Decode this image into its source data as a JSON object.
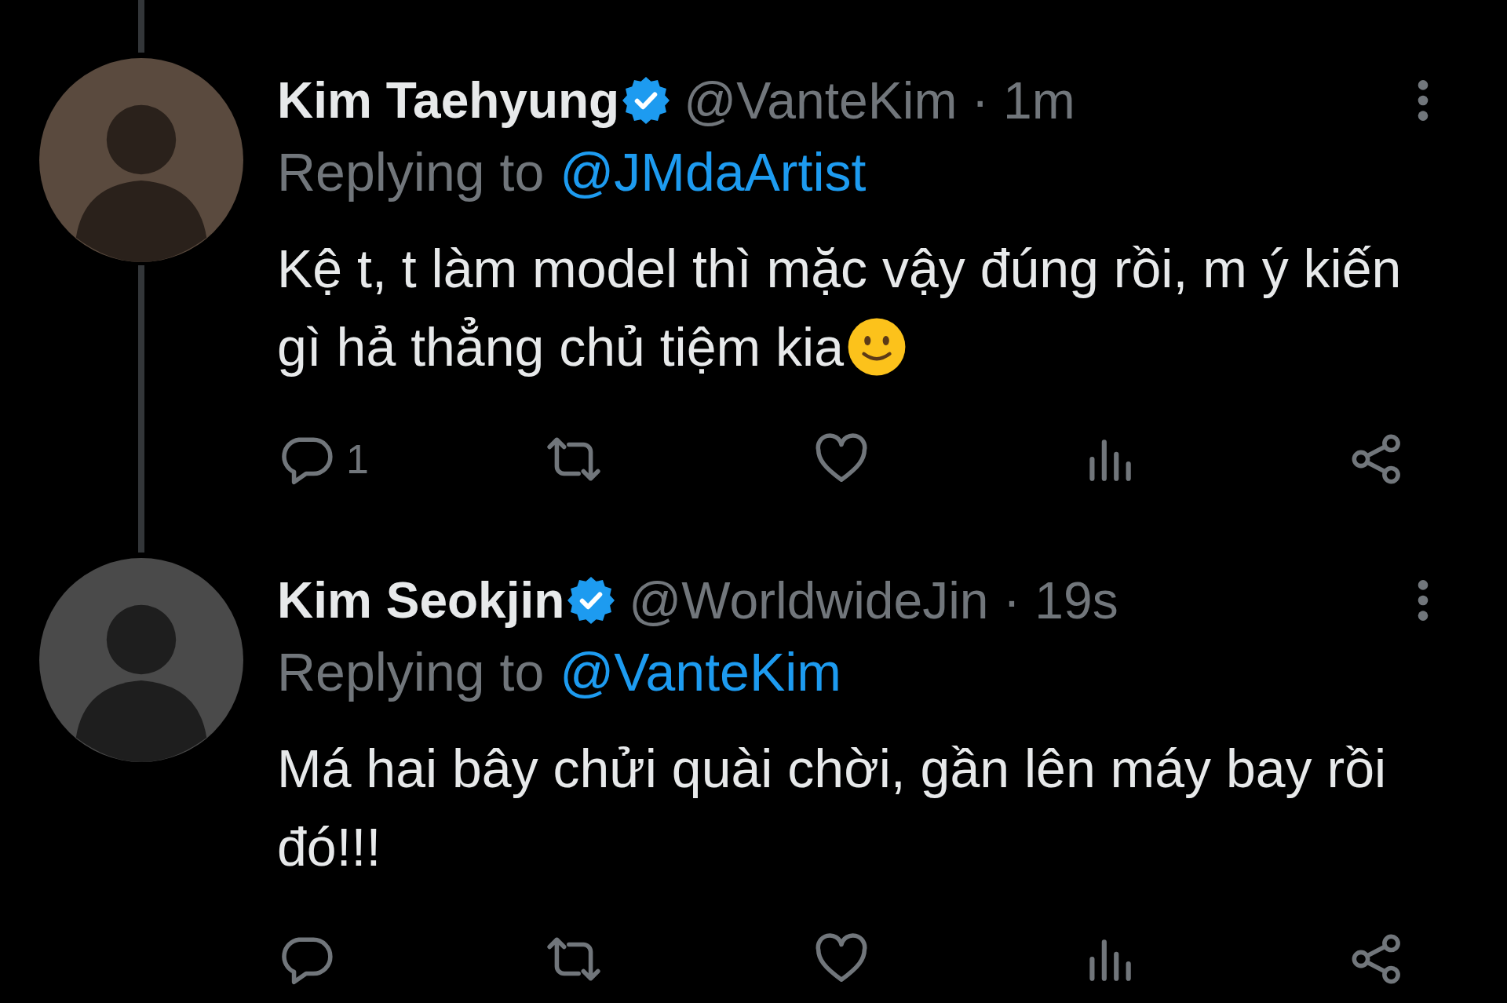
{
  "tweets": [
    {
      "name": "Kim Taehyung",
      "verified": true,
      "meta": "@VanteKim · 1m",
      "replying_label": "Replying to",
      "reply_to": "@JMdaArtist",
      "text": "Kệ t, t làm model thì mặc vậy đúng rồi, m ý kiến gì hả thẳng chủ tiệm kia",
      "ends_with_smiley": true,
      "reply_count": "1",
      "thread_above": true,
      "thread_below": true
    },
    {
      "name": "Kim Seokjin",
      "verified": true,
      "meta": "@WorldwideJin · 19s",
      "replying_label": "Replying to",
      "reply_to": "@VanteKim",
      "text": "Má hai bây chửi quài chời, gần lên máy bay rồi đó!!!",
      "ends_with_smiley": false,
      "thread_above": true,
      "thread_below": false
    }
  ]
}
